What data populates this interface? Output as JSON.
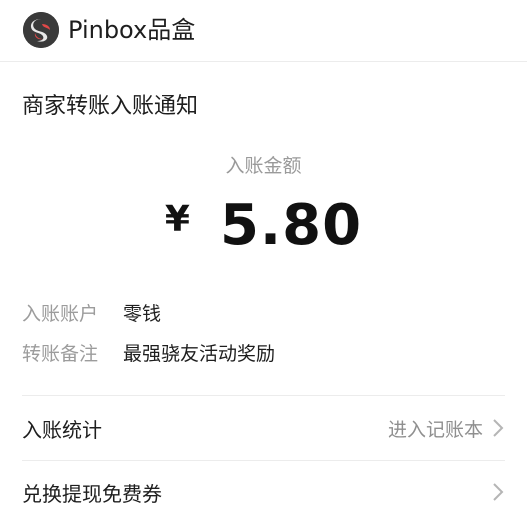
{
  "header": {
    "app_name": "Pinbox品盒",
    "logo_icon": "pinbox-logo-icon"
  },
  "card": {
    "title": "商家转账入账通知",
    "amount_label": "入账金额",
    "currency_symbol": "¥",
    "amount": "5.80",
    "details": [
      {
        "label": "入账账户",
        "value": "零钱"
      },
      {
        "label": "转账备注",
        "value": "最强骁友活动奖励"
      }
    ]
  },
  "links": {
    "stats_label": "入账统计",
    "stats_action": "进入记账本",
    "redeem_label": "兑换提现免费券"
  },
  "colors": {
    "text": "#1e1e1e",
    "muted": "#9c9c9c",
    "divider": "#ececec"
  }
}
